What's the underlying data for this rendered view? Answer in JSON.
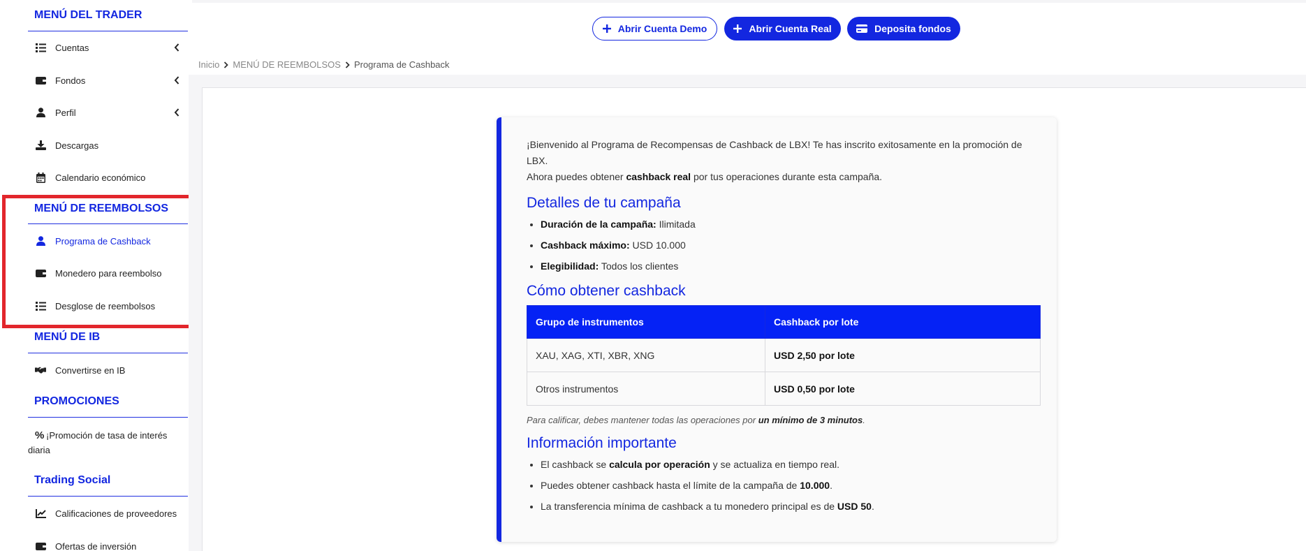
{
  "sidebar": {
    "sections": {
      "trader": "MENÚ DEL TRADER",
      "reembolsos": "MENÚ DE REEMBOLSOS",
      "ib": "MENÚ DE IB",
      "promociones": "PROMOCIONES",
      "social": "Trading Social"
    },
    "items": {
      "cuentas": "Cuentas",
      "fondos": "Fondos",
      "perfil": "Perfil",
      "descargas": "Descargas",
      "calendario": "Calendario económico",
      "cashback": "Programa de Cashback",
      "monedero": "Monedero para reembolso",
      "desglose": "Desglose de reembolsos",
      "convertirse": "Convertirse en IB",
      "promocion_tasa": "¡Promoción de tasa de interés diaria",
      "calificaciones": "Calificaciones de proveedores",
      "ofertas": "Ofertas de inversión"
    },
    "active_item": "cashback"
  },
  "topbar": {
    "demo": "Abrir Cuenta Demo",
    "real": "Abrir Cuenta Real",
    "deposit": "Deposita fondos"
  },
  "breadcrumb": {
    "home": "Inicio",
    "section": "MENÚ DE REEMBOLSOS",
    "current": "Programa de Cashback"
  },
  "card": {
    "intro_1": "¡Bienvenido al Programa de Recompensas de Cashback de LBX! Te has inscrito exitosamente en la promoción de LBX.",
    "intro_2a": "Ahora puedes obtener ",
    "intro_2b": "cashback real",
    "intro_2c": " por tus operaciones durante esta campaña.",
    "details_title": "Detalles de tu campaña",
    "details": [
      {
        "label": "Duración de la campaña:",
        "value": " Ilimitada"
      },
      {
        "label": "Cashback máximo:",
        "value": " USD 10.000"
      },
      {
        "label": "Elegibilidad:",
        "value": " Todos los clientes"
      }
    ],
    "how_title": "Cómo obtener cashback",
    "table": {
      "headers": [
        "Grupo de instrumentos",
        "Cashback por lote"
      ],
      "rows": [
        [
          "XAU, XAG, XTI, XBR, XNG",
          "USD 2,50 por lote"
        ],
        [
          "Otros instrumentos",
          "USD 0,50 por lote"
        ]
      ]
    },
    "note_a": "Para calificar, debes mantener todas las operaciones por ",
    "note_b": "un mínimo de 3 minutos",
    "note_c": ".",
    "info_title": "Información importante",
    "info": [
      {
        "a": "El cashback se ",
        "b": "calcula por operación",
        "c": " y se actualiza en tiempo real."
      },
      {
        "a": "Puedes obtener cashback hasta el límite de la campaña de ",
        "b": "10.000",
        "c": "."
      },
      {
        "a": "La transferencia mínima de cashback a tu monedero principal es de ",
        "b": "USD 50",
        "c": "."
      }
    ]
  },
  "colors": {
    "accent": "#1327e0",
    "table_header": "#0522f5",
    "highlight_box": "#e2262c"
  }
}
